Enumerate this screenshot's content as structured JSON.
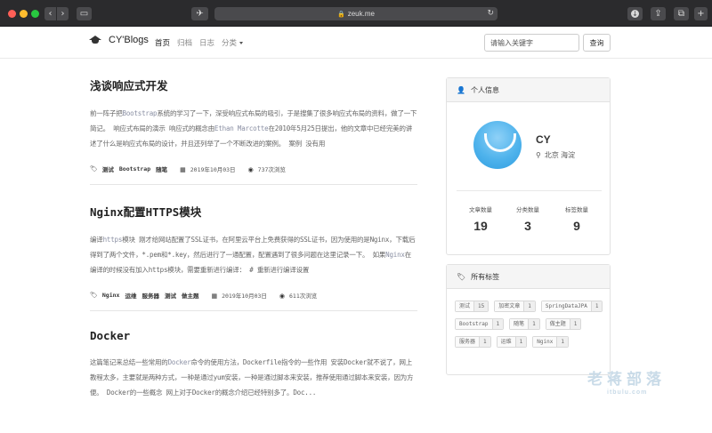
{
  "browser": {
    "url": "zeuk.me",
    "lock_glyph": "🔒",
    "back_glyph": "‹",
    "forward_glyph": "›",
    "sidebar_glyph": "▭",
    "extension_glyph": "✈",
    "reload_glyph": "↻",
    "download_glyph": "↓",
    "share_glyph": "⇪",
    "tabs_glyph": "⧉",
    "add_glyph": "+"
  },
  "site": {
    "brand": "CY'Blogs",
    "nav": [
      {
        "label": "首页"
      },
      {
        "label": "归档"
      },
      {
        "label": "日志"
      },
      {
        "label": "分类"
      }
    ],
    "search_placeholder": "请输入关键字",
    "search_button": "查询"
  },
  "posts": [
    {
      "title": "浅谈响应式开发",
      "excerpt_parts": [
        {
          "text": "前一阵子把",
          "hl": false
        },
        {
          "text": "Bootstrap",
          "hl": true
        },
        {
          "text": "系统的学习了一下，深受响应式布局的吸引，于是搜集了很多响应式布局的资料，做了一下简记。 响应式布局的演示 响应式的概念由",
          "hl": false
        },
        {
          "text": "Ethan Marcotte",
          "hl": true
        },
        {
          "text": "在2010年5月25日提出，他的文章中已经完美的讲述了什么是响应式布局的设计，并且还列举了一个不断改进的案例。 案例 没有用",
          "hl": false
        }
      ],
      "tags": [
        "测试",
        "Bootstrap",
        "随笔"
      ],
      "date": "2019年10月03日",
      "views": "737次浏览"
    },
    {
      "title": "Nginx配置HTTPS模块",
      "excerpt_parts": [
        {
          "text": "编译",
          "hl": false
        },
        {
          "text": "https",
          "hl": true
        },
        {
          "text": "模块 刚才给网站配置了SSL证书，在阿里云平台上免费获得的SSL证书，因为使用的是Nginx，下载后得到了两个文件，*.pem和*.key，然后进行了一通配置，配置遇到了很多问题在这里记录一下。 如果",
          "hl": false
        },
        {
          "text": "Nginx",
          "hl": true
        },
        {
          "text": "在编译的时候没有加入https模块，需要重新进行编译： # 重新进行编译设置",
          "hl": false
        }
      ],
      "tags": [
        "Nginx",
        "运维",
        "服务器",
        "测试",
        "做主题"
      ],
      "date": "2019年10月03日",
      "views": "611次浏览"
    },
    {
      "title": "Docker",
      "excerpt_parts": [
        {
          "text": "这篇笔记来总结一些常用的",
          "hl": false
        },
        {
          "text": "Docker",
          "hl": true
        },
        {
          "text": "命令的使用方法，Dockerfile指令的一些作用 安装Docker就不说了，网上教程太多，主要就是两种方式，一种是通过yum安装，一种是通过脚本来安装，推荐使用通过脚本来安装，因为方便。 Docker的一些概念 网上对于Docker的概念介绍已经特别多了。Doc...",
          "hl": false
        }
      ],
      "tags": [],
      "date": "",
      "views": ""
    }
  ],
  "profile": {
    "header": "个人信息",
    "name": "CY",
    "location": "北京 海淀",
    "stats": [
      {
        "label": "文章数量",
        "value": "19"
      },
      {
        "label": "分类数量",
        "value": "3"
      },
      {
        "label": "标签数量",
        "value": "9"
      }
    ]
  },
  "tag_panel": {
    "header": "所有标签",
    "tags": [
      {
        "name": "测试",
        "count": "15"
      },
      {
        "name": "加密文章",
        "count": "1"
      },
      {
        "name": "SpringDataJPA",
        "count": "1"
      },
      {
        "name": "Bootstrap",
        "count": "1"
      },
      {
        "name": "随笔",
        "count": "1"
      },
      {
        "name": "做主题",
        "count": "1"
      },
      {
        "name": "服务器",
        "count": "1"
      },
      {
        "name": "运维",
        "count": "1"
      },
      {
        "name": "Nginx",
        "count": "1"
      }
    ]
  },
  "watermark": {
    "line1": "老蒋部落",
    "line2": "itbulu.com"
  },
  "icons": {
    "user": "user-icon",
    "tags": "tags-icon",
    "pin": "map-marker-icon",
    "calendar": "calendar-icon",
    "eye": "eye-icon",
    "cap": "graduation-cap-icon"
  }
}
